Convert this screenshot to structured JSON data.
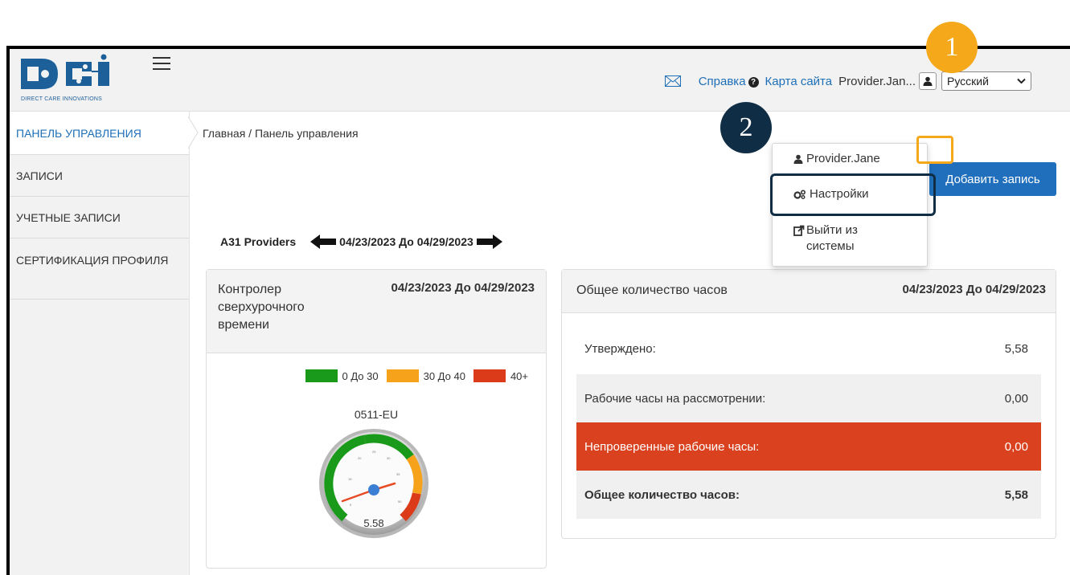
{
  "brand": {
    "tagline": "DIRECT CARE INNOVATIONS"
  },
  "header": {
    "help_label": "Справка",
    "sitemap_label": "Карта сайта",
    "username": "Provider.Jan...",
    "language": "Русский"
  },
  "user_menu": {
    "username": "Provider.Jane",
    "settings_label": "Настройки",
    "logout_line1": "Выйти из",
    "logout_line2": "системы"
  },
  "sidebar": {
    "items": [
      {
        "label": "ПАНЕЛЬ УПРАВЛЕНИЯ"
      },
      {
        "label": "ЗАПИСИ"
      },
      {
        "label": "УЧЕТНЫЕ ЗАПИСИ"
      },
      {
        "label": "СЕРТИФИКАЦИЯ ПРОФИЛЯ"
      }
    ]
  },
  "breadcrumb": "Главная / Панель управления",
  "add_record_label": "Добавить запись",
  "period": {
    "group": "A31 Providers",
    "range": "04/23/2023 До 04/29/2023"
  },
  "overtime_card": {
    "title": "Контролер сверхурочного времени",
    "date_range": "04/23/2023 До 04/29/2023",
    "legend": [
      {
        "label": "0 До 30",
        "color": "#1a9a1a"
      },
      {
        "label": "30 До 40",
        "color": "#f7a21b"
      },
      {
        "label": "40+",
        "color": "#dc3b1a"
      }
    ],
    "gauge_label": "0511-EU",
    "gauge_value": "5.58"
  },
  "hours_card": {
    "title": "Общее количество часов",
    "date_range": "04/23/2023 До 04/29/2023",
    "rows": [
      {
        "label": "Утверждено:",
        "value": "5,58"
      },
      {
        "label": "Рабочие часы на рассмотрении:",
        "value": "0,00"
      },
      {
        "label": "Непроверенные рабочие часы:",
        "value": "0,00"
      },
      {
        "label": "Общее количество часов:",
        "value": "5,58"
      }
    ]
  },
  "callouts": {
    "one": "1",
    "two": "2"
  },
  "colors": {
    "accent": "#1f6fbd",
    "callout1": "#f4a81a",
    "callout2": "#0f2e45",
    "danger": "#d9411f"
  }
}
